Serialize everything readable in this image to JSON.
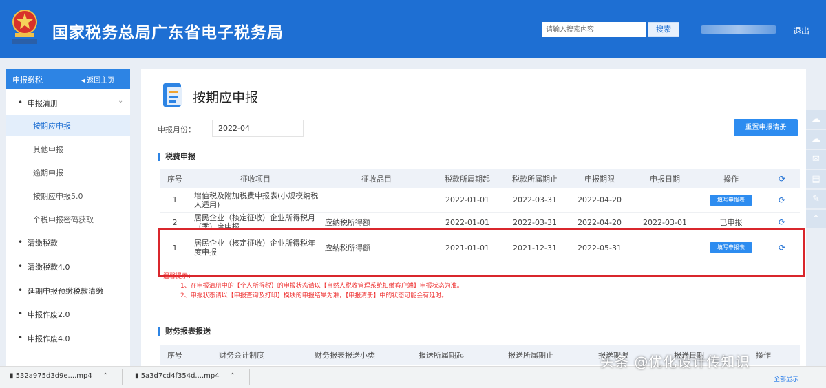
{
  "header": {
    "title": "国家税务总局广东省电子税务局",
    "search_placeholder": "请输入搜索内容",
    "search_button": "搜索",
    "logout": "退出",
    "brand_color": "#1e6fd3"
  },
  "sidebar": {
    "section_title": "申报缴税",
    "home_label": "返回主页",
    "items": [
      {
        "label": "申报清册",
        "icon": "bullet",
        "expanded": true
      },
      {
        "label": "按期应申报",
        "active": true
      },
      {
        "label": "其他申报"
      },
      {
        "label": "逾期申报"
      },
      {
        "label": "按期应申报5.0"
      },
      {
        "label": "个税申报密码获取"
      },
      {
        "label": "清缴税款",
        "icon": "bullet"
      },
      {
        "label": "清缴税款4.0",
        "icon": "bullet"
      },
      {
        "label": "延期申报预缴税款清缴",
        "icon": "bullet"
      },
      {
        "label": "申报作废2.0",
        "icon": "bullet"
      },
      {
        "label": "申报作废4.0",
        "icon": "bullet"
      }
    ]
  },
  "main": {
    "page_title": "按期应申报",
    "period_label": "申报月份：",
    "period_value": "2022-04",
    "reset_button": "重置申报清册",
    "tax_section_title": "税费申报",
    "tax_table": {
      "headers": [
        "序号",
        "征收项目",
        "征收品目",
        "税款所属期起",
        "税款所属期止",
        "申报期限",
        "申报日期",
        "操作"
      ],
      "rows": [
        {
          "no": "1",
          "item": "增值税及附加税费申报表(小规模纳税人适用)",
          "sub": "",
          "start": "2022-01-01",
          "end": "2022-03-31",
          "deadline": "2022-04-20",
          "date": "",
          "action": "填写申报表",
          "action_type": "button"
        },
        {
          "no": "2",
          "item": "居民企业（核定征收）企业所得税月（季）度申报",
          "sub": "应纳税所得额",
          "start": "2022-01-01",
          "end": "2022-03-31",
          "deadline": "2022-04-20",
          "date": "2022-03-01",
          "action": "已申报",
          "action_type": "text"
        },
        {
          "no": "1",
          "item": "居民企业（核定征收）企业所得税年度申报",
          "sub": "应纳税所得额",
          "start": "2021-01-01",
          "end": "2021-12-31",
          "deadline": "2022-05-31",
          "date": "",
          "action": "填写申报表",
          "action_type": "button"
        }
      ]
    },
    "notes_title": "温馨提示：",
    "notes": [
      "1、在申报清册中的【个人所得税】的申报状态请以【自然人税收管理系统扣缴客户端】申报状态为准。",
      "2、申报状态请以【申报查询及打印】模块的申报结果为准，【申报清册】中的状态可能会有延时。"
    ],
    "finance_section_title": "财务报表报送",
    "finance_table": {
      "headers": [
        "序号",
        "财务会计制度",
        "财务报表报送小类",
        "报送所属期起",
        "报送所属期止",
        "报送期限",
        "报送日期",
        "操作"
      ]
    }
  },
  "downloads": [
    {
      "name": "532a975d3d9e....mp4"
    },
    {
      "name": "5a3d7cd4f354d....mp4"
    }
  ],
  "downloads_show_all": "全部显示",
  "watermark": "头条 @优化设计传知识",
  "highlight_color": "#d9262c"
}
